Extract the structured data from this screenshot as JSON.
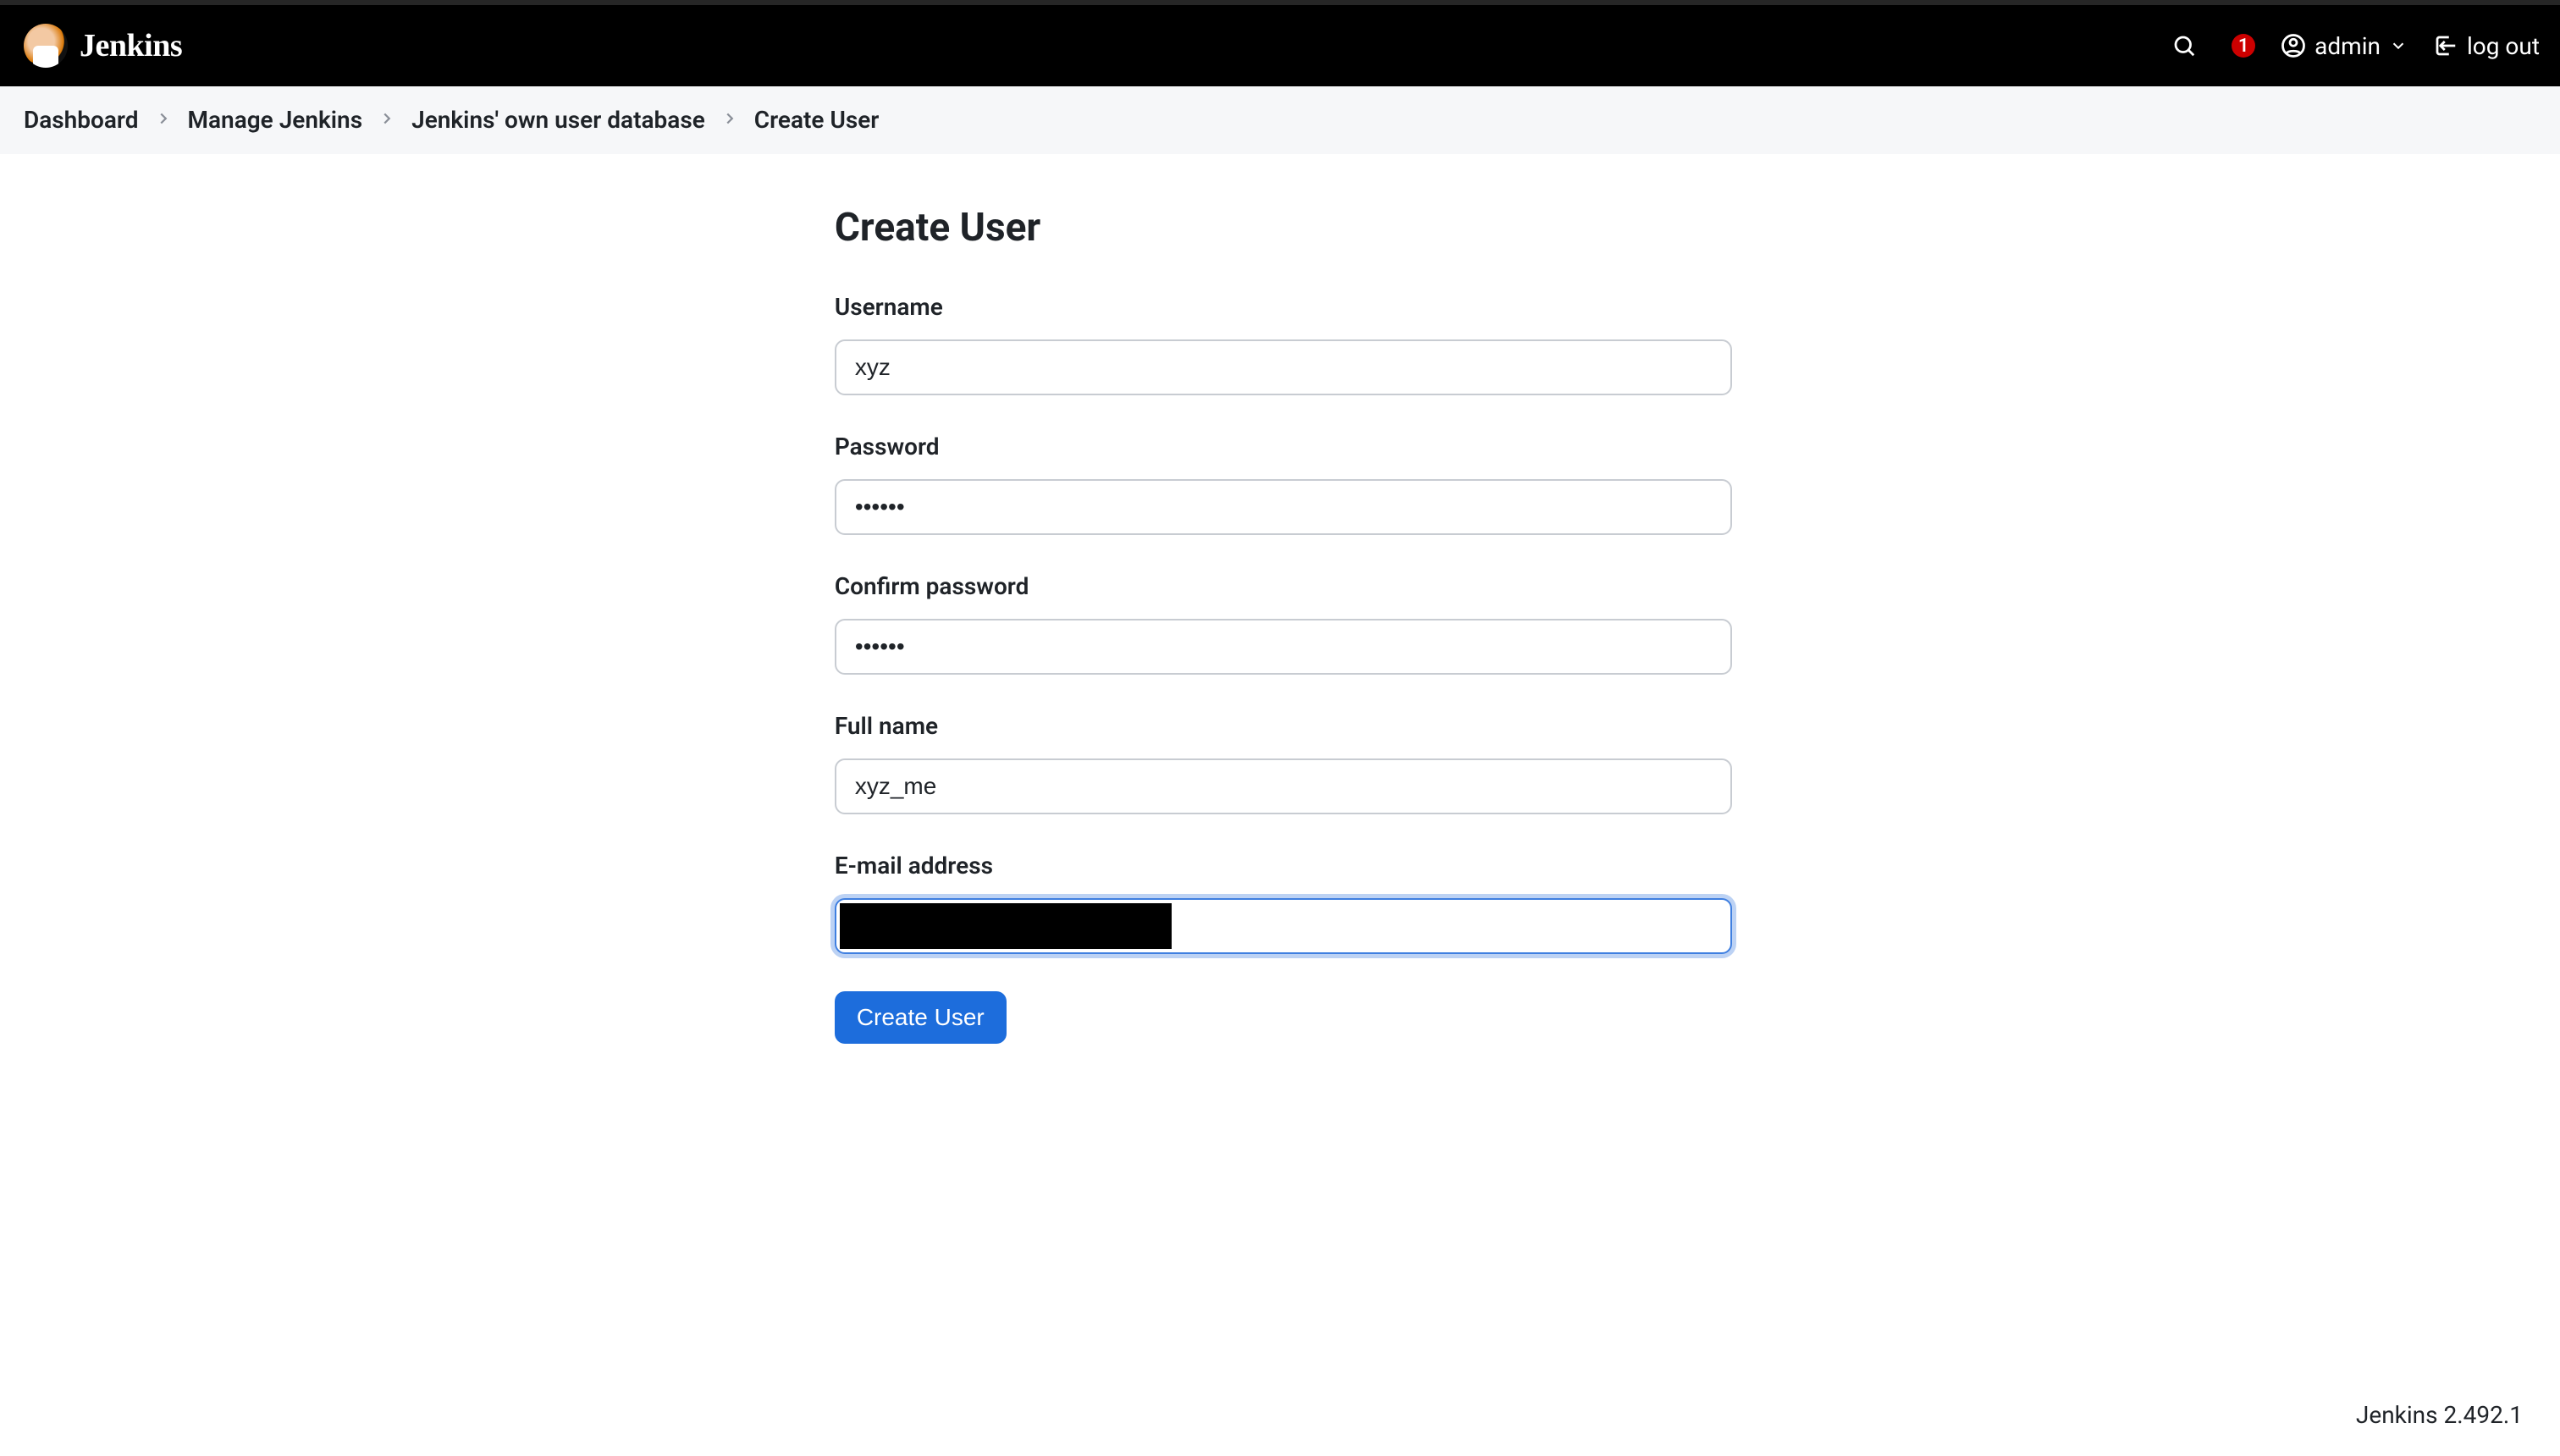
{
  "brand": {
    "name": "Jenkins"
  },
  "header": {
    "alerts_count": "1",
    "user_label": "admin",
    "logout_label": "log out"
  },
  "breadcrumbs": {
    "items": [
      {
        "label": "Dashboard"
      },
      {
        "label": "Manage Jenkins"
      },
      {
        "label": "Jenkins' own user database"
      },
      {
        "label": "Create User"
      }
    ]
  },
  "page": {
    "title": "Create User",
    "form": {
      "username_label": "Username",
      "username_value": "xyz",
      "password_label": "Password",
      "password_value": "••••••",
      "confirm_label": "Confirm password",
      "confirm_value": "••••••",
      "fullname_label": "Full name",
      "fullname_value": "xyz_me",
      "email_label": "E-mail address",
      "email_value": "",
      "submit_label": "Create User"
    }
  },
  "footer": {
    "version_label": "Jenkins 2.492.1"
  }
}
